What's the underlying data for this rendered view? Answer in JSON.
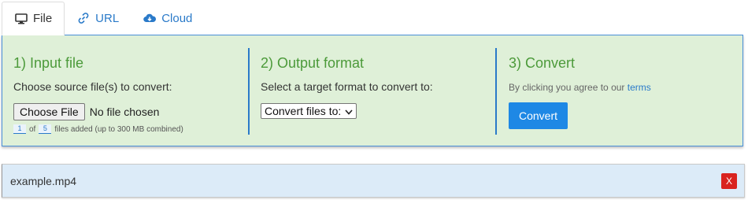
{
  "tabs": [
    {
      "label": "File",
      "icon": "monitor-icon",
      "active": true
    },
    {
      "label": "URL",
      "icon": "link-icon",
      "active": false
    },
    {
      "label": "Cloud",
      "icon": "cloud-download-icon",
      "active": false
    }
  ],
  "steps": {
    "input": {
      "title": "1) Input file",
      "subtitle": "Choose source file(s) to convert:",
      "choose_button": "Choose File",
      "no_file_text": "No file chosen",
      "count_current": "1",
      "count_of": "of",
      "count_max": "5",
      "count_suffix": "files added (up to 300 MB combined)"
    },
    "output": {
      "title": "2) Output format",
      "subtitle": "Select a target format to convert to:",
      "select_value": "Convert files to:"
    },
    "convert": {
      "title": "3) Convert",
      "agree_text": "By clicking you agree to our ",
      "terms_link": "terms",
      "button": "Convert"
    }
  },
  "file_item": {
    "name": "example.mp4",
    "remove_label": "X"
  },
  "colors": {
    "accent": "#2a7ac9",
    "panel_bg": "#dff0d8",
    "step_title": "#4c9a3a",
    "convert_button": "#1e88e5",
    "remove_button": "#d9231f",
    "file_item_bg": "#dcebf8"
  }
}
